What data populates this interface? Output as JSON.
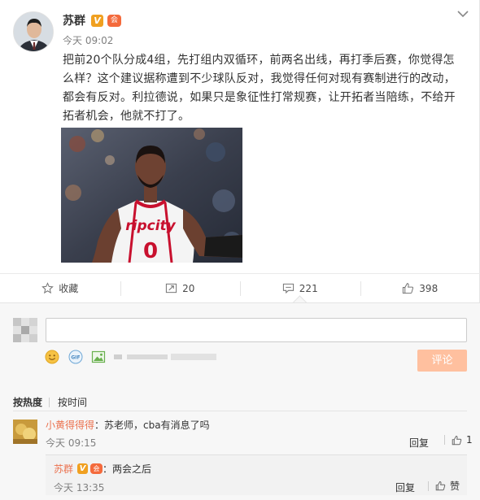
{
  "post": {
    "author": "苏群",
    "verified_badge": "V",
    "level_badge": "会",
    "time": "今天 09:02",
    "text": "把前20个队分成4组，先打组内双循环，前两名出线，再打季后赛，你觉得怎么样？这个建议据称遭到不少球队反对，我觉得任何对现有赛制进行的改动，都会有反对。利拉德说，如果只是象征性打常规赛，让开拓者当陪练，不给开拓者机会，他就不打了。",
    "image": {
      "jersey_logo": "ripcity",
      "jersey_number": "0"
    }
  },
  "actions": {
    "favorite_label": "收藏",
    "repost_count": "20",
    "comment_count": "221",
    "like_count": "398"
  },
  "comment_box": {
    "placeholder": "",
    "submit_label": "评论"
  },
  "sort": {
    "hot_label": "按热度",
    "time_label": "按时间"
  },
  "comments": [
    {
      "user": "小黄得得得",
      "separator": "：",
      "text": "苏老师，cba有消息了吗",
      "time": "今天 09:15",
      "reply_label": "回复",
      "likes": "1"
    }
  ],
  "reply": {
    "user": "苏群",
    "verified_badge": "V",
    "level_badge": "会",
    "separator": "：",
    "text": "两会之后",
    "time": "今天 13:35",
    "reply_label": "回复",
    "like_label": "赞"
  },
  "colors": {
    "nickname": "#eb7350",
    "submit_button": "#ffc09f",
    "verified": "#f0a020"
  }
}
